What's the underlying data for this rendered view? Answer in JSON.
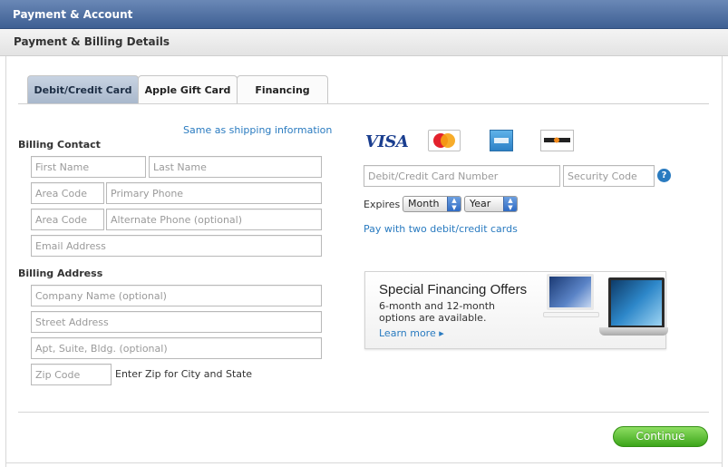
{
  "header": {
    "title": "Payment & Account",
    "subtitle": "Payment & Billing Details"
  },
  "tabs": [
    {
      "label": "Debit/Credit Card",
      "active": true
    },
    {
      "label": "Apple Gift Card",
      "active": false
    },
    {
      "label": "Financing",
      "active": false
    }
  ],
  "billing": {
    "same_as_shipping": "Same as shipping information",
    "contact_title": "Billing Contact",
    "first_name_ph": "First Name",
    "last_name_ph": "Last Name",
    "area_code_ph": "Area Code",
    "primary_phone_ph": "Primary Phone",
    "area_code2_ph": "Area Code",
    "alt_phone_ph": "Alternate Phone (optional)",
    "email_ph": "Email Address",
    "address_title": "Billing Address",
    "company_ph": "Company Name (optional)",
    "street_ph": "Street Address",
    "apt_ph": "Apt, Suite, Bldg. (optional)",
    "zip_ph": "Zip Code",
    "zip_note": "Enter Zip for City and State"
  },
  "payment": {
    "card_logos": {
      "visa": "VISA",
      "mastercard": "MasterCard",
      "amex": "AMERICAN EXPRESS",
      "discover": "DISCOVER"
    },
    "card_number_ph": "Debit/Credit Card Number",
    "security_code_ph": "Security Code",
    "help_symbol": "?",
    "expires_label": "Expires",
    "month_value": "Month",
    "year_value": "Year",
    "two_cards_link": "Pay with two debit/credit cards"
  },
  "promo": {
    "title": "Special Financing Offers",
    "body": "6-month and 12-month\noptions are available.",
    "link": "Learn more ▸"
  },
  "footer": {
    "continue_label": "Continue"
  },
  "colors": {
    "header_blue": "#3e5f93",
    "link_blue": "#2a7bc0",
    "continue_green": "#3ca51a",
    "active_tab": "#a9b8cc"
  }
}
